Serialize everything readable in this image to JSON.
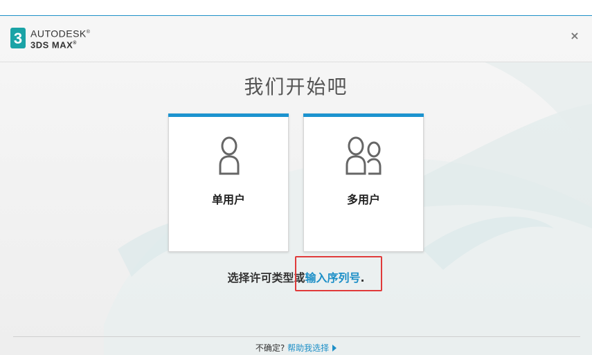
{
  "brand": {
    "line1": "AUTODESK",
    "line1_mark": "®",
    "line2": "3DS MAX",
    "line2_mark": "®",
    "logo_glyph": "3",
    "logo_color": "#1aa3a6"
  },
  "header": {
    "close_glyph": "×"
  },
  "page": {
    "title": "我们开始吧"
  },
  "license_options": [
    {
      "label": "单用户",
      "icon": "single-user-icon"
    },
    {
      "label": "多用户",
      "icon": "multi-user-icon"
    }
  ],
  "prompt": {
    "text": "选择许可类型或",
    "link": "输入序列号",
    "suffix": "."
  },
  "footer": {
    "question": "不确定?",
    "help_link": "帮助我选择"
  },
  "colors": {
    "accent": "#1c93cf",
    "link": "#1d8fc7",
    "highlight": "#e03a3a"
  }
}
